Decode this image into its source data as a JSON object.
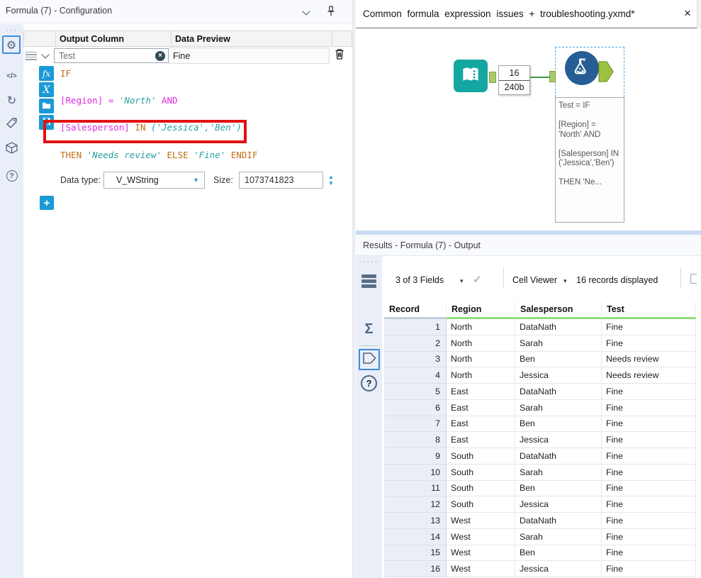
{
  "colors": {
    "accent_blue": "#1B9AD6",
    "selection_blue": "#3F8CDB",
    "field_magenta": "#E02BE0",
    "string_teal": "#2BA0A0",
    "keyword_orange": "#BE6E10",
    "highlight_red": "#E01212",
    "anchor_green": "#A9C96A",
    "connection_green": "#3E9C3A",
    "tool_teal": "#12A7A0",
    "tool_blue": "#265D94",
    "header_underline_green": "#90DC78",
    "sidebar_bg": "#E9EEF8"
  },
  "icon_glyphs": {
    "gear": "⚙",
    "code": "</>",
    "refresh": "↻",
    "sigma": "Σ",
    "question": "?",
    "check": "✓",
    "close": "×",
    "clear": "×",
    "caret_down": "▾",
    "spinner_up": "▲",
    "spinner_down": "▼",
    "fx": "fx",
    "chi": "X",
    "dots3": "···",
    "dots5": "·····"
  },
  "config_panel": {
    "title": "Formula (7) - Configuration",
    "columns": {
      "output": "Output Column",
      "preview": "Data Preview"
    },
    "field_row": {
      "name": "Test",
      "preview": "Fine"
    },
    "expression_lines": [
      [
        [
          "IF",
          "kw"
        ]
      ],
      [
        [
          "[Region] = ",
          "mag"
        ],
        [
          "'North'",
          "str"
        ],
        [
          " AND",
          "mag"
        ]
      ],
      [
        [
          "[Salesperson]",
          "mag"
        ],
        [
          " IN ",
          "kw"
        ],
        [
          "('Jessica','Ben')",
          "str"
        ]
      ],
      [
        [
          "THEN ",
          "kw"
        ],
        [
          "'Needs review'",
          "str"
        ],
        [
          " ELSE ",
          "kw"
        ],
        [
          "'Fine'",
          "str"
        ],
        [
          " ENDIF",
          "kw"
        ]
      ]
    ],
    "data_type": {
      "label": "Data type:",
      "value": "V_WString"
    },
    "size": {
      "label": "Size:",
      "value": "1073741823"
    },
    "add_button": "+"
  },
  "canvas": {
    "tab_title": "Common formula expression issues + troubleshooting.yxmd*",
    "connection_label": {
      "records": "16",
      "size": "240b"
    },
    "annotation_lines": [
      "Test = IF",
      "",
      "[Region] =",
      "'North' AND",
      "",
      "[Salesperson] IN",
      "('Jessica','Ben')",
      "",
      "THEN 'Ne..."
    ]
  },
  "results_panel": {
    "title": "Results - Formula (7) - Output",
    "toolbar": {
      "fields": "3 of 3 Fields",
      "cell_viewer": "Cell Viewer",
      "records": "16 records displayed"
    },
    "table": {
      "headers": [
        "Record",
        "Region",
        "Salesperson",
        "Test"
      ],
      "rows": [
        [
          "1",
          "North",
          "DataNath",
          "Fine"
        ],
        [
          "2",
          "North",
          "Sarah",
          "Fine"
        ],
        [
          "3",
          "North",
          "Ben",
          "Needs review"
        ],
        [
          "4",
          "North",
          "Jessica",
          "Needs review"
        ],
        [
          "5",
          "East",
          "DataNath",
          "Fine"
        ],
        [
          "6",
          "East",
          "Sarah",
          "Fine"
        ],
        [
          "7",
          "East",
          "Ben",
          "Fine"
        ],
        [
          "8",
          "East",
          "Jessica",
          "Fine"
        ],
        [
          "9",
          "South",
          "DataNath",
          "Fine"
        ],
        [
          "10",
          "South",
          "Sarah",
          "Fine"
        ],
        [
          "11",
          "South",
          "Ben",
          "Fine"
        ],
        [
          "12",
          "South",
          "Jessica",
          "Fine"
        ],
        [
          "13",
          "West",
          "DataNath",
          "Fine"
        ],
        [
          "14",
          "West",
          "Sarah",
          "Fine"
        ],
        [
          "15",
          "West",
          "Ben",
          "Fine"
        ],
        [
          "16",
          "West",
          "Jessica",
          "Fine"
        ]
      ]
    }
  }
}
